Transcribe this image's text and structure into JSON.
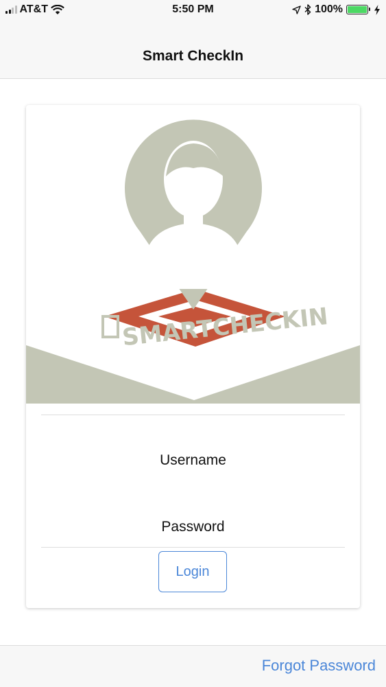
{
  "status_bar": {
    "carrier": "AT&T",
    "time": "5:50 PM",
    "battery_percent": "100%",
    "signal_bars_filled": 2,
    "signal_bars_total": 4,
    "battery_level": 1.0,
    "icons": [
      "signal-icon",
      "wifi-icon",
      "location-arrow-icon",
      "bluetooth-icon",
      "battery-icon",
      "charging-bolt-icon"
    ]
  },
  "nav": {
    "title": "Smart CheckIn"
  },
  "logo": {
    "wordmark": "SMARTCHECKIN",
    "colors": {
      "pin": "#c3c6b5",
      "square": "#c5543a",
      "bg": "#ffffff"
    }
  },
  "login_form": {
    "username_label": "Username",
    "password_label": "Password",
    "login_button_label": "Login"
  },
  "footer": {
    "forgot_password_label": "Forgot Password"
  },
  "colors": {
    "accent": "#4a86d8",
    "bar_background": "#f7f7f7"
  }
}
